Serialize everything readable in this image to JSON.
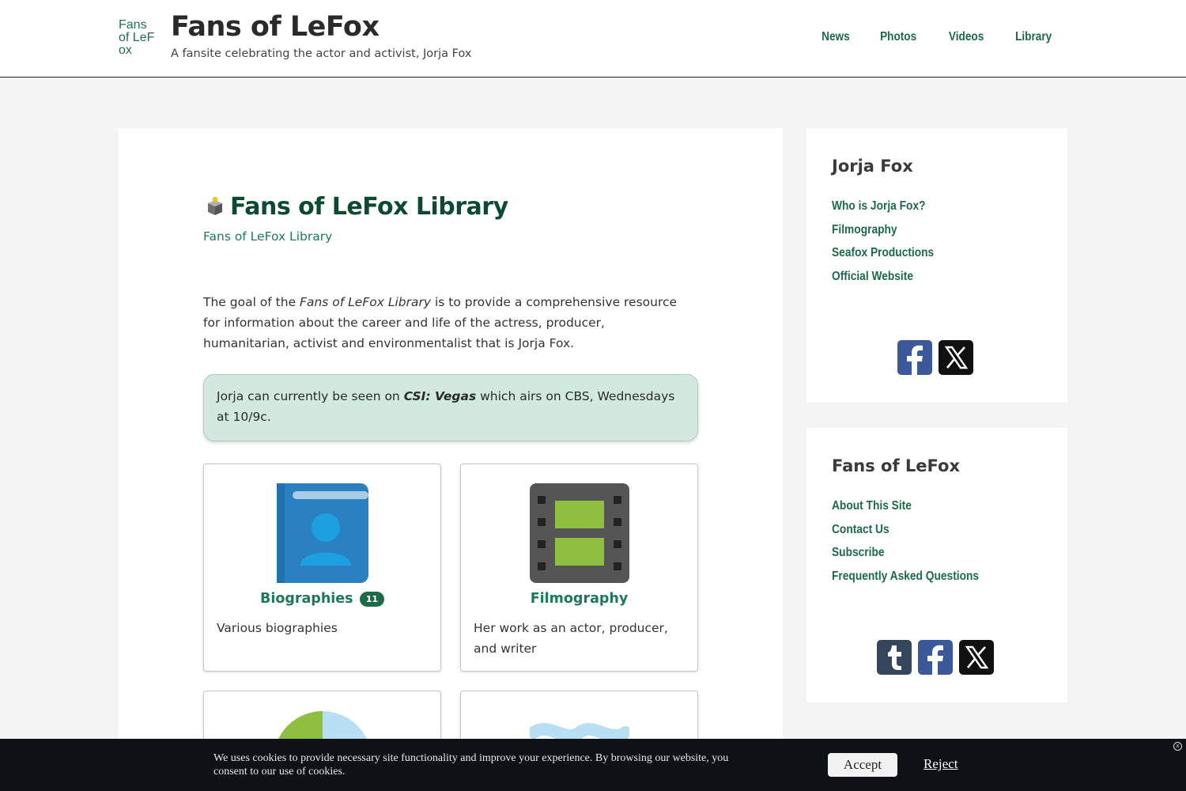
{
  "header": {
    "logo_alt": "Fans of LeFox",
    "title": "Fans of LeFox",
    "tagline": "A fansite celebrating the actor and activist, Jorja Fox",
    "nav": [
      "News",
      "Photos",
      "Videos",
      "Library"
    ]
  },
  "main": {
    "title": "Fans of LeFox Library",
    "breadcrumb": "Fans of LeFox Library",
    "intro_before": "The goal of the ",
    "intro_em": "Fans of LeFox Library",
    "intro_after": " is to provide a comprehensive resource for information about the career and life of the actress, producer, humanitarian, activist and environmentalist that is Jorja Fox.",
    "notice_before": "Jorja can currently be seen on ",
    "notice_show": "CSI: Vegas",
    "notice_after": " which airs on CBS, Wednesdays at 10/9c.",
    "cards": [
      {
        "title": "Biographies",
        "badge": "11",
        "desc": "Various biographies",
        "icon": "biography-book-icon"
      },
      {
        "title": "Filmography",
        "desc": "Her work as an actor, producer, and writer",
        "icon": "film-strip-icon"
      }
    ]
  },
  "sidebar": {
    "widget1": {
      "title": "Jorja Fox",
      "links": [
        "Who is Jorja Fox?",
        "Filmography",
        "Seafox Productions",
        "Official Website"
      ],
      "social": [
        "facebook-icon",
        "x-icon"
      ]
    },
    "widget2": {
      "title": "Fans of LeFox",
      "links": [
        "About This Site",
        "Contact Us",
        "Subscribe",
        "Frequently Asked Questions"
      ],
      "social": [
        "tumblr-icon",
        "facebook-icon",
        "x-icon"
      ]
    }
  },
  "cookie": {
    "text": "We uses cookies to provide necessary site functionality and improve your experience. By browsing our website, you consent to our use of cookies.",
    "accept": "Accept",
    "reject": "Reject",
    "close_symbol": "x"
  },
  "colors": {
    "accent_green": "#1d6a48",
    "title_green": "#0d4a30",
    "notice_bg": "#d2e9df",
    "facebook": "#3b5998",
    "x": "#111111",
    "tumblr": "#35465c"
  }
}
